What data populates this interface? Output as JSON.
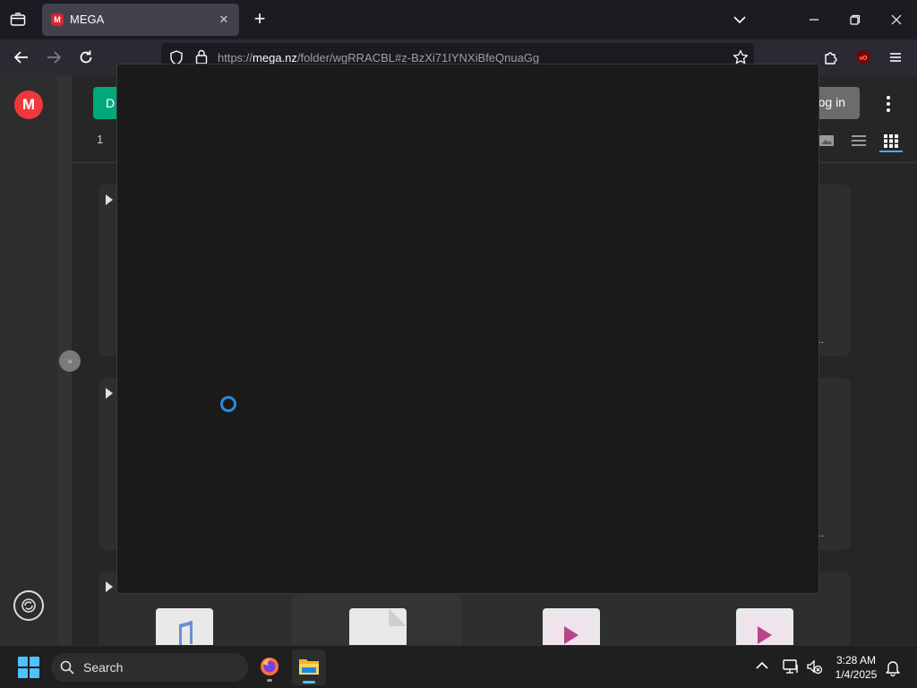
{
  "browser": {
    "tab_title": "MEGA",
    "favicon_letter": "M",
    "tab_close": "✕",
    "new_tab": "+",
    "url_scheme": "https://",
    "url_host": "mega.nz",
    "url_path": "/folder/wgRRACBL#z-BzXi71IYNXiBfeQnuaGg"
  },
  "mega": {
    "logo_letter": "M",
    "download_label_fragment": "D",
    "login_label_fragment": "og in",
    "breadcrumb_fragment": "1",
    "collapse_symbol": "»",
    "ellipsis": "..."
  },
  "taskbar": {
    "search_label": "Search",
    "time": "3:28 AM",
    "date": "1/4/2025"
  },
  "colors": {
    "mega_red": "#f0373a",
    "mega_green": "#00a87c",
    "spinner_blue": "#2f8ad6",
    "windows_blue": "#4cc2ff"
  }
}
